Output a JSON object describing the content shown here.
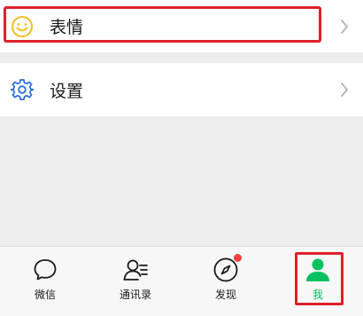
{
  "menu": {
    "emoji_label": "表情",
    "settings_label": "设置"
  },
  "tabs": [
    {
      "label": "微信",
      "icon": "chat-bubble-icon"
    },
    {
      "label": "通讯录",
      "icon": "contacts-icon"
    },
    {
      "label": "发现",
      "icon": "compass-icon",
      "badge": "red-dot"
    },
    {
      "label": "我",
      "icon": "person-icon",
      "selected": true
    }
  ],
  "colors": {
    "accent_green": "#07c160",
    "emoji_yellow": "#f0c020",
    "settings_blue": "#2a6fdb",
    "highlight_red": "#e0202a",
    "badge_red": "#f04040"
  }
}
